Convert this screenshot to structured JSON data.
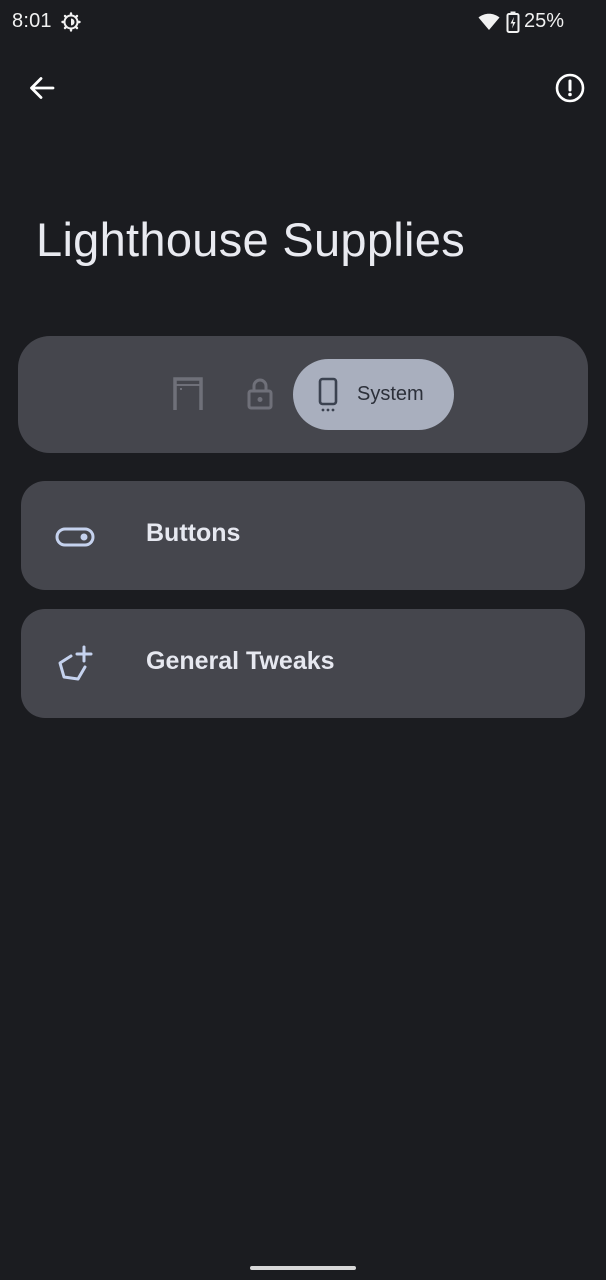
{
  "status_bar": {
    "time": "8:01",
    "battery_percent": "25%",
    "icons": [
      "settings-gear-icon",
      "wifi-icon",
      "battery-charging-icon"
    ]
  },
  "header": {
    "back_icon": "arrow-back-icon",
    "info_icon": "info-exclamation-icon"
  },
  "page": {
    "title": "Lighthouse Supplies"
  },
  "tabs": [
    {
      "icon": "home-icon",
      "label": "",
      "selected": false
    },
    {
      "icon": "lock-icon",
      "label": "",
      "selected": false
    },
    {
      "icon": "phone-icon",
      "label": "System",
      "selected": true
    }
  ],
  "cards": [
    {
      "icon": "toggle-icon",
      "label": "Buttons"
    },
    {
      "icon": "tweaks-plus-icon",
      "label": "General Tweaks"
    }
  ],
  "colors": {
    "background": "#1b1c20",
    "surface": "#45464d",
    "selected_tab": "#a9afbe",
    "accent_icon": "#c5d2ee"
  }
}
